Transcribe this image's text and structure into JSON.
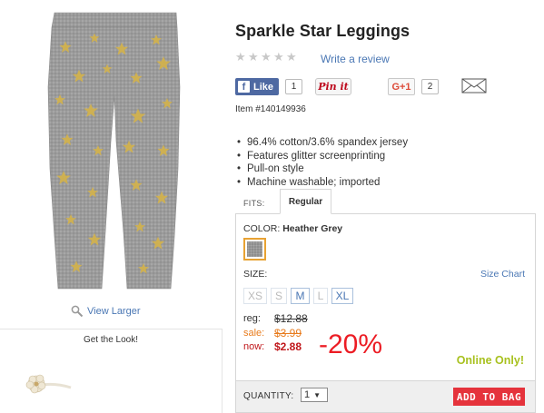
{
  "product": {
    "title": "Sparkle Star Leggings",
    "item_number": "Item #140149936",
    "rating_stars": 0,
    "write_review": "Write a review",
    "features": [
      "96.4% cotton/3.6% spandex jersey",
      "Features glitter screenprinting",
      "Pull-on style",
      "Machine washable; imported"
    ],
    "image_icon": "gray-leggings-with-gold-stars"
  },
  "gallery": {
    "view_larger": "View Larger",
    "get_the_look": "Get the Look!"
  },
  "social": {
    "like_label": "Like",
    "like_count": "1",
    "pinit_label": "Pin it",
    "gplus_label": "G+1",
    "gplus_count": "2"
  },
  "fits": {
    "label": "FITS:",
    "selected": "Regular"
  },
  "color": {
    "label": "COLOR:",
    "value": "Heather Grey"
  },
  "size": {
    "label": "SIZE:",
    "chart_link": "Size Chart",
    "options": [
      {
        "label": "XS",
        "available": false
      },
      {
        "label": "S",
        "available": false
      },
      {
        "label": "M",
        "available": true
      },
      {
        "label": "L",
        "available": false
      },
      {
        "label": "XL",
        "available": true
      }
    ]
  },
  "pricing": {
    "reg_label": "reg:",
    "reg_value": "$12.88",
    "sale_label": "sale:",
    "sale_value": "$3.99",
    "now_label": "now:",
    "now_value": "$2.88",
    "discount": "-20%",
    "online_only": "Online Only!"
  },
  "cart": {
    "quantity_label": "QUANTITY:",
    "quantity_value": "1",
    "add_to_bag": "ADD TO BAG"
  },
  "colors": {
    "link": "#4a77b4",
    "sale": "#e87c1e",
    "now": "#c0171b",
    "discount": "#ec1c24",
    "online": "#a8c11f",
    "add_bag": "#e5333c",
    "fb": "#4e69a2"
  }
}
